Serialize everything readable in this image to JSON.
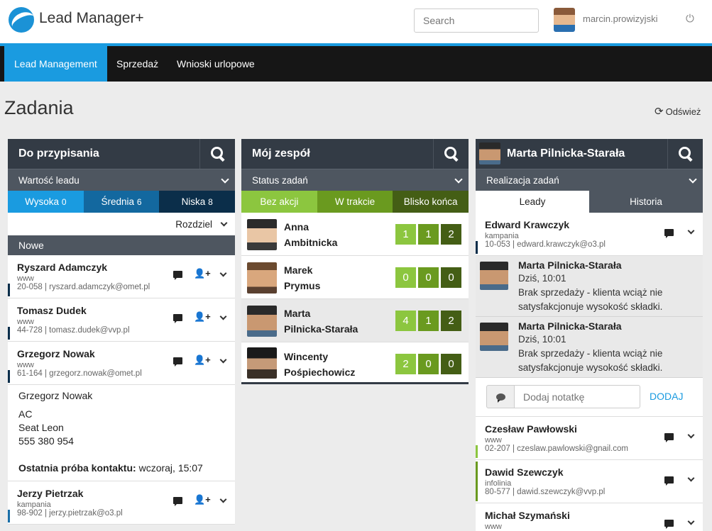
{
  "header": {
    "app_title": "Lead Manager+",
    "search_placeholder": "Search",
    "username": "marcin.prowizyjski"
  },
  "nav": [
    "Lead Management",
    "Sprzedaż",
    "Wnioski urlopowe"
  ],
  "page": {
    "title": "Zadania",
    "refresh_label": "Odśwież"
  },
  "left": {
    "title": "Do przypisania",
    "filter": "Wartość leadu",
    "tabs": [
      {
        "label": "Wysoka",
        "count": "0"
      },
      {
        "label": "Średnia",
        "count": "6"
      },
      {
        "label": "Niska",
        "count": "8"
      }
    ],
    "assign_label": "Rozdziel",
    "section": "Nowe",
    "leads": [
      {
        "name": "Ryszard Adamczyk",
        "type": "www",
        "contact": "20-058 | ryszard.adamczyk@omet.pl"
      },
      {
        "name": "Tomasz Dudek",
        "type": "www",
        "contact": "44-728 | tomasz.dudek@vvp.pl"
      },
      {
        "name": "Grzegorz Nowak",
        "type": "www",
        "contact": "61-164 | grzegorz.nowak@omet.pl"
      },
      {
        "name": "Jerzy Pietrzak",
        "type": "kampania",
        "contact": "98-902 | jerzy.pietrzak@o3.pl"
      }
    ],
    "details": {
      "name": "Grzegorz Nowak",
      "line1": "AC",
      "line2": "Seat Leon",
      "line3": "555 380 954",
      "last_contact_label": "Ostatnia próba kontaktu:",
      "last_contact_value": "wczoraj, 15:07"
    }
  },
  "middle": {
    "title": "Mój zespół",
    "filter": "Status zadań",
    "tabs": [
      "Bez akcji",
      "W trakcie",
      "Blisko końca"
    ],
    "members": [
      {
        "first": "Anna",
        "last": "Ambitnicka",
        "counts": [
          "1",
          "1",
          "2"
        ]
      },
      {
        "first": "Marek",
        "last": "Prymus",
        "counts": [
          "0",
          "0",
          "0"
        ]
      },
      {
        "first": "Marta",
        "last": "Pilnicka-Starała",
        "counts": [
          "4",
          "1",
          "2"
        ]
      },
      {
        "first": "Wincenty",
        "last": "Pośpiechowicz",
        "counts": [
          "2",
          "0",
          "0"
        ]
      }
    ]
  },
  "right": {
    "title": "Marta Pilnicka-Starała",
    "filter": "Realizacja zadań",
    "tabs": [
      "Leady",
      "Historia"
    ],
    "active_lead": {
      "name": "Edward Krawczyk",
      "type": "kampania",
      "contact": "10-053 | edward.krawczyk@o3.pl"
    },
    "notes": [
      {
        "author": "Marta Pilnicka-Starała",
        "date": "Dziś, 10:01",
        "text": "Brak sprzedaży - klienta wciąż nie satysfakcjonuje wysokość składki."
      },
      {
        "author": "Marta Pilnicka-Starała",
        "date": "Dziś, 10:01",
        "text": "Brak sprzedaży - klienta wciąż nie satysfakcjonuje wysokość składki."
      }
    ],
    "note_placeholder": "Dodaj notatkę",
    "add_label": "DODAJ",
    "leads": [
      {
        "name": "Czesław Pawłowski",
        "type": "www",
        "contact": "02-207 | czeslaw.pawlowski@gnail.com"
      },
      {
        "name": "Dawid Szewczyk",
        "type": "infolinia",
        "contact": "80-577 | dawid.szewczyk@vvp.pl"
      },
      {
        "name": "Michał Szymański",
        "type": "www",
        "contact": ""
      }
    ]
  },
  "colors": {
    "accent": "#1a9be0",
    "tab_high": "#1a9be0",
    "tab_mid": "#13689f",
    "tab_low": "#0b2e4a",
    "green_1": "#8cc63f",
    "green_2": "#6a9a1f",
    "green_3": "#445e15"
  }
}
